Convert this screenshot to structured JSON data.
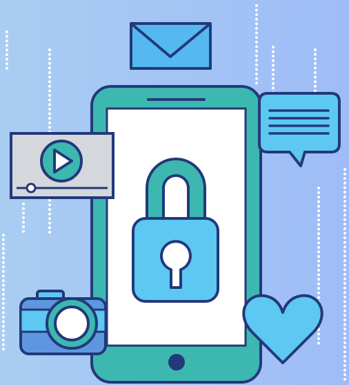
{
  "illustration": {
    "subject": "smartphone-security",
    "icons": [
      "mail-icon",
      "chat-bubble-icon",
      "video-player-icon",
      "padlock-icon",
      "camera-icon",
      "heart-icon"
    ],
    "colors": {
      "background_left": "#a9cdf2",
      "background_right": "#9fbcf7",
      "outline": "#22397a",
      "teal": "#3db8b1",
      "light_blue": "#5dc8f2",
      "sky_blue": "#55b8f0",
      "screen_white": "#ffffff",
      "video_panel": "#d4d7dc",
      "camera_body": "#5e97e0",
      "dots": "#ffffff"
    }
  }
}
